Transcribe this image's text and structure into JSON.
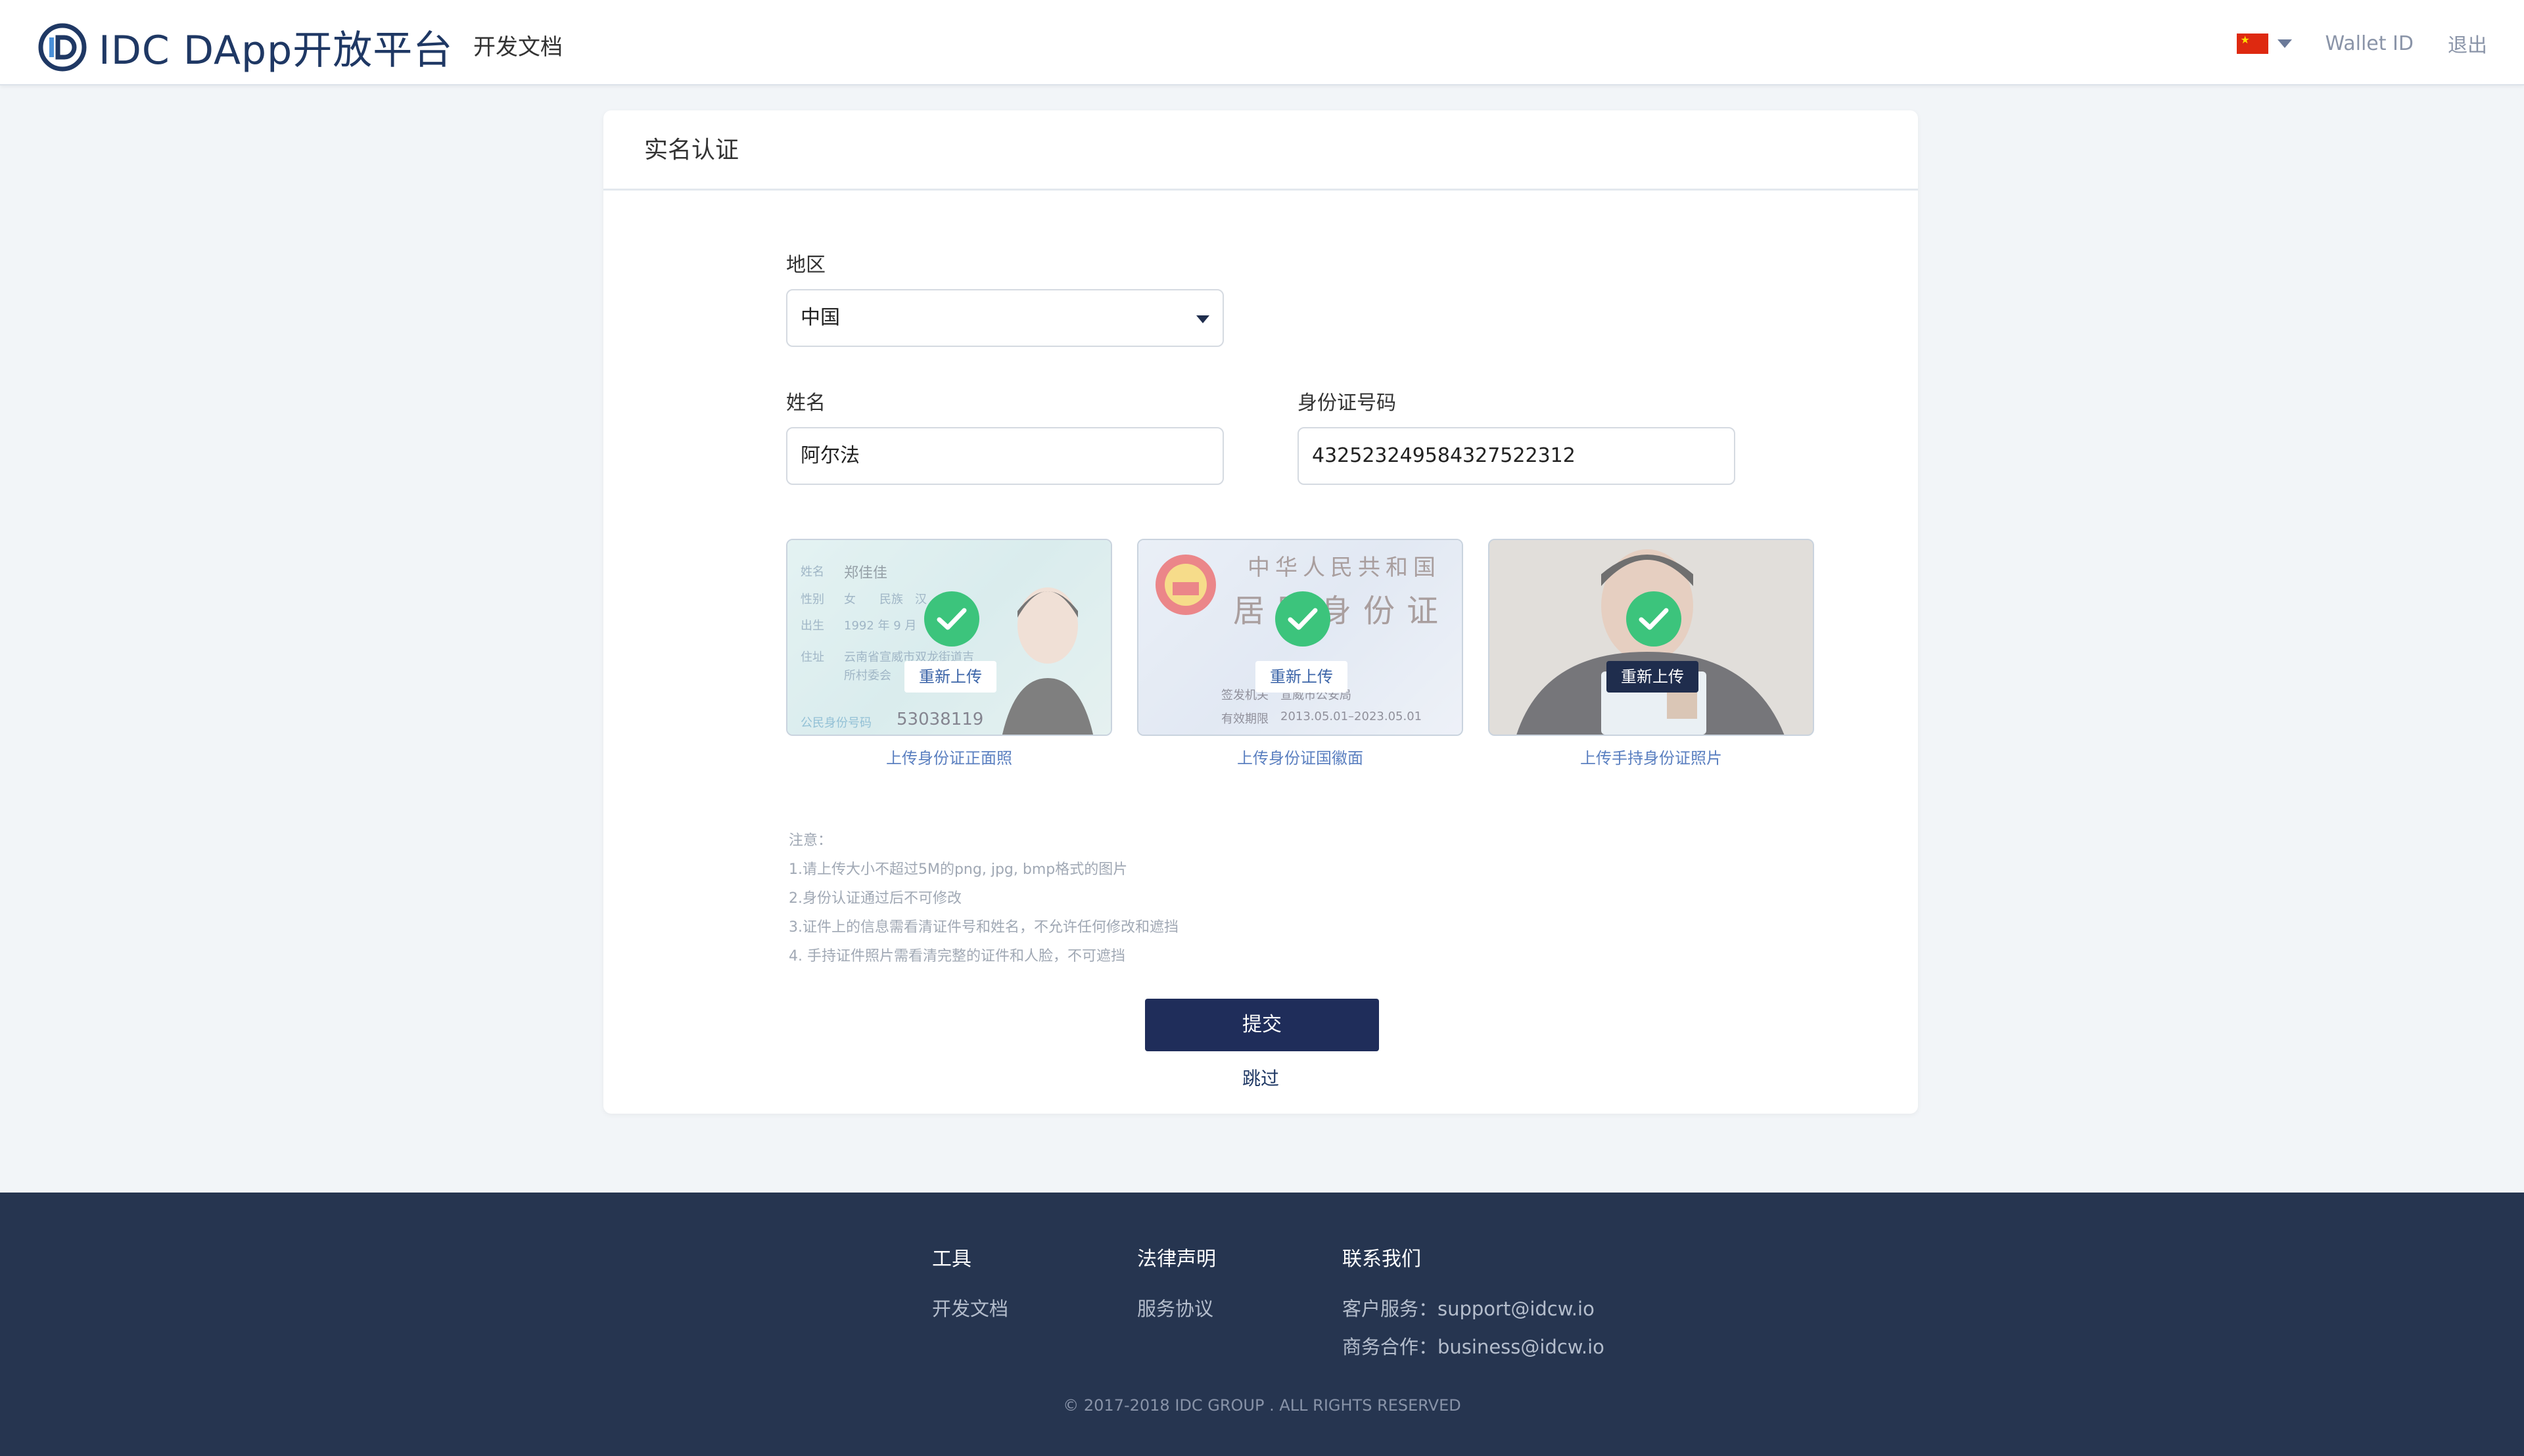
{
  "header": {
    "brand": "IDC DApp开放平台",
    "nav_docs": "开发文档",
    "wallet_id": "Wallet ID",
    "logout": "退出",
    "language_flag": "china-flag-icon"
  },
  "card": {
    "title": "实名认证",
    "region_label": "地区",
    "region_value": "中国",
    "name_label": "姓名",
    "name_value": "阿尔法",
    "id_label": "身份证号码",
    "id_value": "432523249584327522312"
  },
  "uploads": [
    {
      "caption": "上传身份证正面照",
      "reupload": "重新上传",
      "card_text": {
        "name_key": "姓名",
        "name_val": "郑佳佳",
        "sex_key": "性别",
        "sex_val": "女",
        "nation_key": "民族",
        "nation_val": "汉",
        "birth_key": "出生",
        "birth_val": "1992 年 9 月",
        "addr_key": "住址",
        "addr_val1": "云南省宣威市双龙街道吉",
        "addr_val2": "所村委会",
        "num_key": "公民身份号码",
        "num_val": "53038119"
      }
    },
    {
      "caption": "上传身份证国徽面",
      "reupload": "重新上传",
      "card_text": {
        "line1": "中华人民共和国",
        "line2": "居民身份证",
        "issuer_key": "签发机关",
        "issuer_val": "宣威市公安局",
        "valid_key": "有效期限",
        "valid_val": "2013.05.01–2023.05.01"
      }
    },
    {
      "caption": "上传手持身份证照片",
      "reupload": "重新上传"
    }
  ],
  "notes": [
    "注意：",
    "1.请上传大小不超过5M的png, jpg, bmp格式的图片",
    "2.身份认证通过后不可修改",
    "3.证件上的信息需看清证件号和姓名，不允许任何修改和遮挡",
    "4. 手持证件照片需看清完整的证件和人脸，不可遮挡"
  ],
  "actions": {
    "submit": "提交",
    "skip": "跳过"
  },
  "footer": {
    "col1": {
      "title": "工具",
      "links": [
        "开发文档"
      ]
    },
    "col2": {
      "title": "法律声明",
      "links": [
        "服务协议"
      ]
    },
    "col3": {
      "title": "联系我们",
      "links": [
        "客户服务：support@idcw.io",
        "商务合作：business@idcw.io"
      ]
    },
    "copyright": "© 2017-2018 IDC GROUP . ALL RIGHTS RESERVED"
  },
  "colors": {
    "brand": "#1f3864",
    "accent_button": "#1f2d5a",
    "success": "#3cc47c",
    "footer_bg": "#263550"
  }
}
